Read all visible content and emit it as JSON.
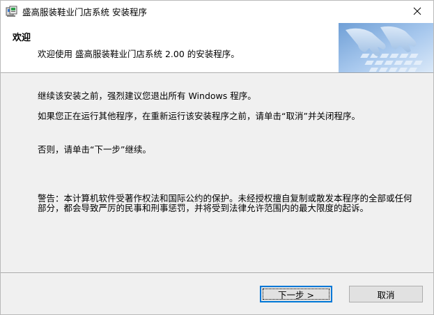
{
  "window": {
    "title": "盛高服装鞋业门店系统 安装程序"
  },
  "header": {
    "title": "欢迎",
    "subtitle": "欢迎使用 盛高服装鞋业门店系统 2.00 的安装程序。"
  },
  "body": {
    "paragraph1": "继续该安装之前，强烈建议您退出所有 Windows 程序。",
    "paragraph2": "如果您正在运行其他程序，在重新运行该安装程序之前，请单击“取消”并关闭程序。",
    "paragraph3": "否则，请单击“下一步”继续。",
    "warning": "警告：本计算机软件受著作权法和国际公约的保护。未经授权擅自复制或散发本程序的全部或任何部分，都会导致严厉的民事和刑事惩罚，并将受到法律允许范围内的最大限度的起诉。"
  },
  "buttons": {
    "next_label": "下一步 >",
    "cancel_label": "取消"
  },
  "icons": {
    "app": "installer-icon",
    "close": "close-icon",
    "banner": "keyboard-hands-banner"
  },
  "colors": {
    "focus_border": "#0078d7",
    "button_face": "#e1e1e1",
    "dialog_bg": "#f0f0f0"
  }
}
